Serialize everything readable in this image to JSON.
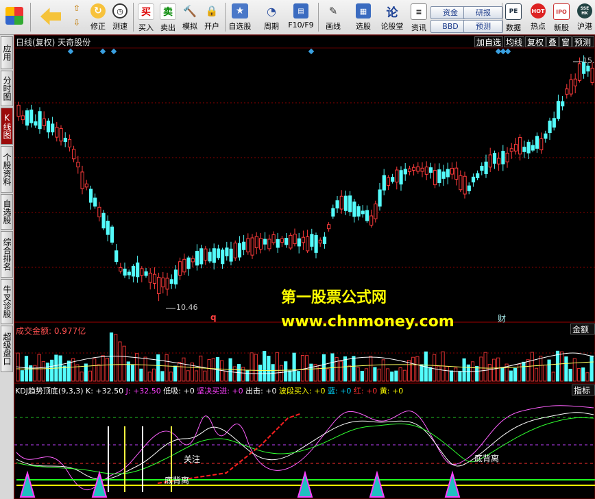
{
  "toolbar": {
    "items": [
      {
        "icon": "window-grid-icon",
        "label": ""
      },
      {
        "icon": "back-arrow-icon",
        "label": ""
      },
      {
        "icon": "up-down-arrow-icon",
        "label": ""
      },
      {
        "icon": "revise-icon",
        "label": "修正"
      },
      {
        "icon": "speed-clock-icon",
        "label": "测速"
      },
      {
        "icon": "buy-icon",
        "label": "买入",
        "glyph": "买"
      },
      {
        "icon": "sell-icon",
        "label": "卖出",
        "glyph": "卖"
      },
      {
        "icon": "gavel-icon",
        "label": "模拟"
      },
      {
        "icon": "lock-icon",
        "label": "开户"
      },
      {
        "icon": "watchlist-star-icon",
        "label": "自选股"
      },
      {
        "icon": "period-clock-icon",
        "label": "周期"
      },
      {
        "icon": "f10-icon",
        "label": "F10/F9"
      },
      {
        "icon": "pen-draw-icon",
        "label": "画线"
      },
      {
        "icon": "stock-screen-icon",
        "label": "选股"
      },
      {
        "icon": "forum-icon",
        "label": "论股堂",
        "glyph": "论"
      },
      {
        "icon": "news-icon",
        "label": "资讯"
      },
      {
        "icon": "data-pe-icon",
        "label": "数据",
        "glyph": "PE"
      },
      {
        "icon": "hot-icon",
        "label": "热点",
        "glyph": "HOT"
      },
      {
        "icon": "ipo-icon",
        "label": "新股",
        "glyph": "IPO"
      },
      {
        "icon": "hk-connect-icon",
        "label": "沪港",
        "glyph": "SSE HK"
      }
    ],
    "pills": [
      "资金",
      "BBD",
      "研报",
      "预测"
    ]
  },
  "sidebar": {
    "tabs": [
      "应用",
      "分时图",
      "K线图",
      "个股资料",
      "自选股",
      "综合排名",
      "牛叉诊股",
      "超级盘口"
    ],
    "active": 2
  },
  "chart": {
    "header": "日线(复权) 天奇股份",
    "right_buttons": [
      "加自选",
      "均线",
      "复权",
      "叠",
      "窗",
      "预测"
    ],
    "high_label": "15.",
    "low_label": "10.46",
    "marker_q": "q",
    "marker_cai": "财",
    "watermark1": "第一股票公式网",
    "watermark2": "www.chnmoney.com"
  },
  "volume": {
    "label": "成交金额: 0.977亿",
    "right_tab": "金额"
  },
  "indicator": {
    "title": "KDJ趋势顶底(9,3,3)",
    "k_label": "K: +32.50",
    "j_label": "J: +32.50",
    "items": [
      {
        "label": "低吸: +0",
        "color": "#ffffff"
      },
      {
        "label": "坚决买进: +0",
        "color": "#ff40ff"
      },
      {
        "label": "出击: +0",
        "color": "#ffffff"
      },
      {
        "label": "波段买入: +0",
        "color": "#ffff00"
      },
      {
        "label": "蓝: +0",
        "color": "#00d8ff"
      },
      {
        "label": "红: +0",
        "color": "#ff3030"
      },
      {
        "label": "黄: +0",
        "color": "#ffff00"
      }
    ],
    "right_tab": "指标",
    "annot_guanzhu": "关注",
    "annot_dibeili": "底背离",
    "annot_dibeili2": "底背离"
  },
  "colors": {
    "up": "#ff3b3b",
    "down": "#54fcfc",
    "bg": "#000000",
    "grid": "#8b0000"
  }
}
